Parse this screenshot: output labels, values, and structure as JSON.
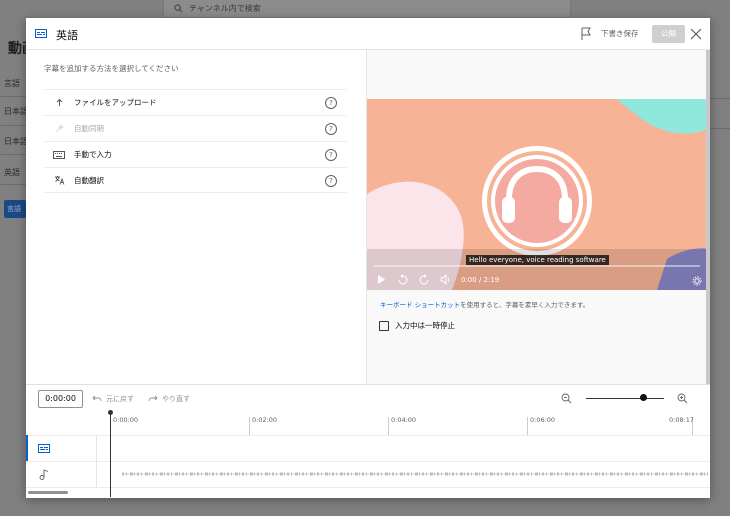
{
  "background": {
    "search_placeholder": "チャンネル内で検索",
    "page_title": "動画",
    "rows": [
      "言語",
      "日本語",
      "日本語",
      "英語"
    ],
    "button_label": "言語"
  },
  "dialog": {
    "title": "英語",
    "draft_label": "下書き保存",
    "publish_label": "公開"
  },
  "left": {
    "instruction": "字幕を追加する方法を選択してください",
    "methods": [
      {
        "label": "ファイルをアップロード",
        "icon": "upload-icon",
        "enabled": true
      },
      {
        "label": "自動同期",
        "icon": "auto-sync-icon",
        "enabled": false
      },
      {
        "label": "手動で入力",
        "icon": "keyboard-icon",
        "enabled": true
      },
      {
        "label": "自動翻訳",
        "icon": "translate-icon",
        "enabled": true
      }
    ],
    "help_glyph": "?"
  },
  "video": {
    "caption": "Hello everyone, voice reading software",
    "time": "0:00 / 2:19",
    "progress": 0
  },
  "right": {
    "shortcut_link": "キーボード ショートカット",
    "shortcut_rest": "を使用すると、字幕を素早く入力できます。",
    "pause_label": "入力中は一時停止",
    "pause_checked": false
  },
  "timeline": {
    "current_time": "0:00:00",
    "undo_label": "元に戻す",
    "redo_label": "やり直す",
    "zoom_level": 0.75,
    "ticks": [
      "0:00:00",
      "0:02:00",
      "0:04:00",
      "0:06:00",
      "0:08:17"
    ]
  },
  "colors": {
    "accent": "#065fd4",
    "video_bg": "#f6b396",
    "publish_disabled": "#cfcfcf"
  }
}
